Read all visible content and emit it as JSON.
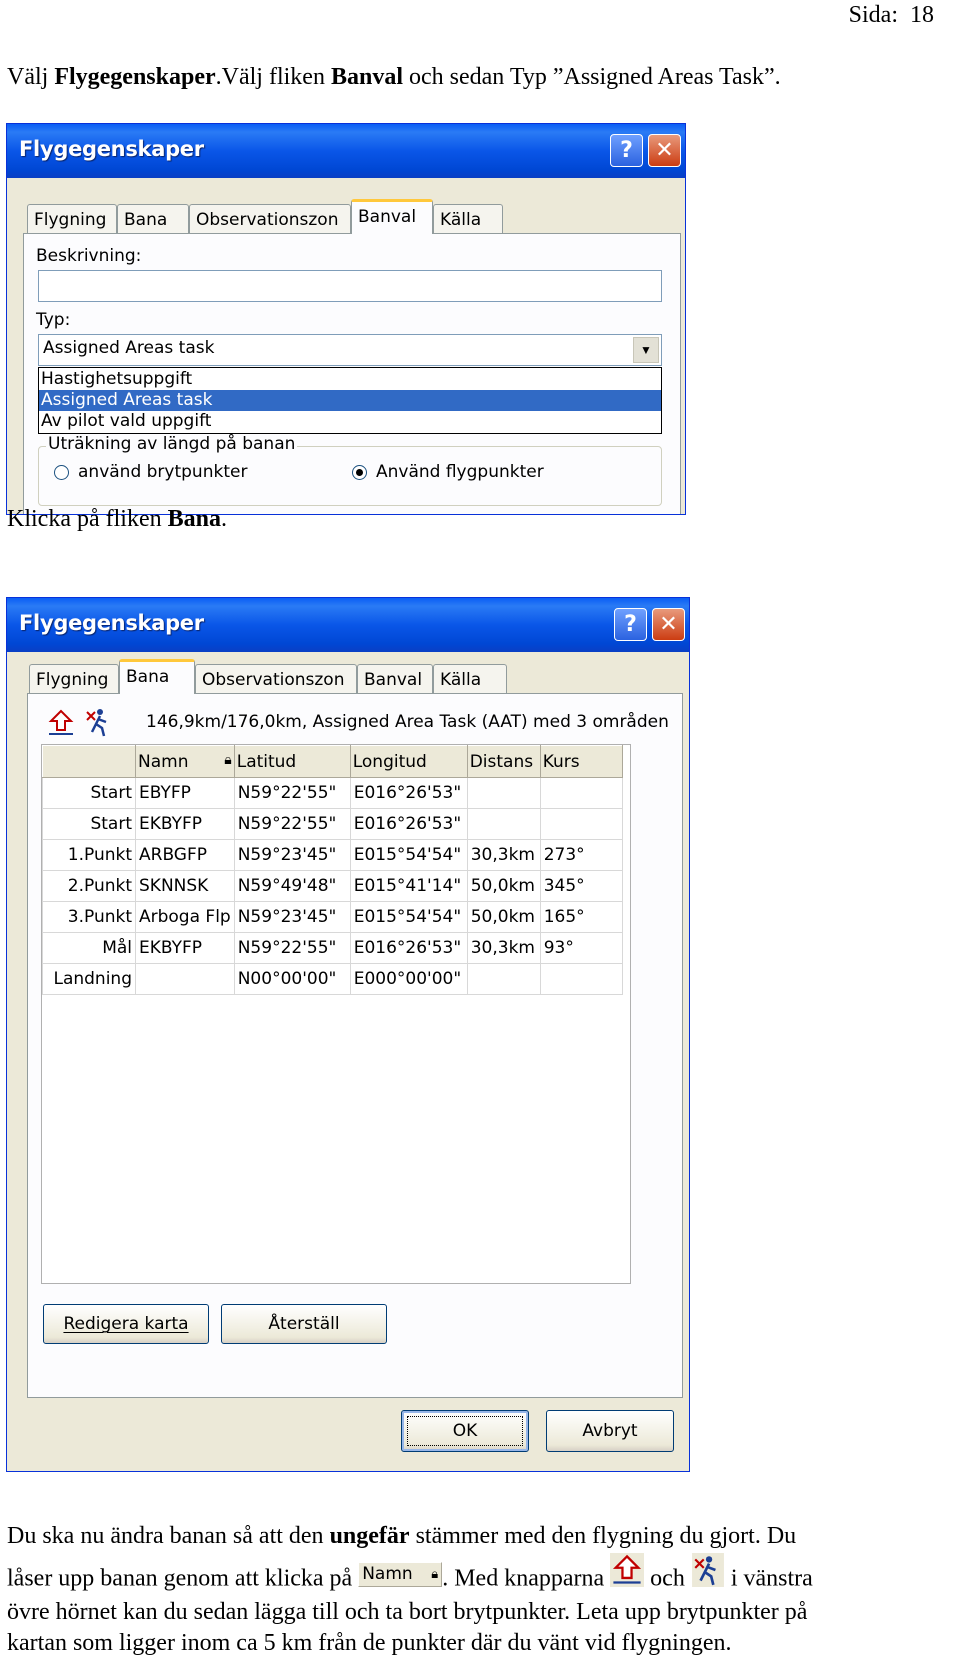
{
  "page": {
    "number_label": "Sida:  18",
    "intro_prefix": "Välj ",
    "intro_b1": "Flygegenskaper",
    "intro_mid": ".Välj fliken ",
    "intro_b2": "Banval",
    "intro_suffix": " och sedan Typ ”Assigned Areas Task”.",
    "bana_prefix": "Klicka på fliken ",
    "bana_b": "Bana",
    "bana_suffix": ".",
    "para1_prefix": "Du ska nu ändra banan så att den ",
    "para1_b": "ungefär",
    "para1_suffix": " stämmer med den flygning du gjort. Du",
    "para2_prefix": "låser upp banan genom att klicka på ",
    "para2_mid": ". Med knapparna ",
    "para2_och": " och ",
    "para2_suffix": " i vänstra",
    "para3": "övre hörnet kan du sedan lägga till och ta bort brytpunkter. Leta upp brytpunkter på",
    "para4": "kartan som ligger inom ca 5 km från de punkter där du vänt vid flygningen.",
    "inline_namn_label": "Namn"
  },
  "dialog1": {
    "title": "Flygegenskaper",
    "help_label": "?",
    "close_label": "✕",
    "tabs": [
      "Flygning",
      "Bana",
      "Observationszon",
      "Banval",
      "Källa"
    ],
    "beskrivning_label": "Beskrivning:",
    "beskrivning_value": "",
    "typ_label": "Typ:",
    "typ_value": "Assigned Areas task",
    "options": [
      "Hastighetsuppgift",
      "Assigned Areas task",
      "Av pilot vald uppgift"
    ],
    "group_title": "Uträkning av längd på banan",
    "radio1": "använd brytpunkter",
    "radio2": "Använd flygpunkter"
  },
  "dialog2": {
    "title": "Flygegenskaper",
    "help_label": "?",
    "close_label": "✕",
    "tabs": [
      "Flygning",
      "Bana",
      "Observationszon",
      "Banval",
      "Källa"
    ],
    "summary": "146,9km/176,0km, Assigned Area Task (AAT) med 3 områden",
    "columns": [
      "",
      "Namn",
      "Latitud",
      "Longitud",
      "Distans",
      "Kurs"
    ],
    "rows": [
      [
        "Start",
        "EBYFP",
        "N59°22'55\"",
        "E016°26'53\"",
        "",
        ""
      ],
      [
        "Start",
        "EKBYFP",
        "N59°22'55\"",
        "E016°26'53\"",
        "",
        ""
      ],
      [
        "1.Punkt",
        "ARBGFP",
        "N59°23'45\"",
        "E015°54'54\"",
        "30,3km",
        "273°"
      ],
      [
        "2.Punkt",
        "SKNNSK",
        "N59°49'48\"",
        "E015°41'14\"",
        "50,0km",
        "345°"
      ],
      [
        "3.Punkt",
        "Arboga Flp",
        "N59°23'45\"",
        "E015°54'54\"",
        "50,0km",
        "165°"
      ],
      [
        "Mål",
        "EKBYFP",
        "N59°22'55\"",
        "E016°26'53\"",
        "30,3km",
        "93°"
      ],
      [
        "Landning",
        "",
        "N00°00'00\"",
        "E000°00'00\"",
        "",
        ""
      ]
    ],
    "btn_redigera": "Redigera karta",
    "btn_aterstall": "Återställ",
    "btn_ok": "OK",
    "btn_avbryt": "Avbryt"
  }
}
